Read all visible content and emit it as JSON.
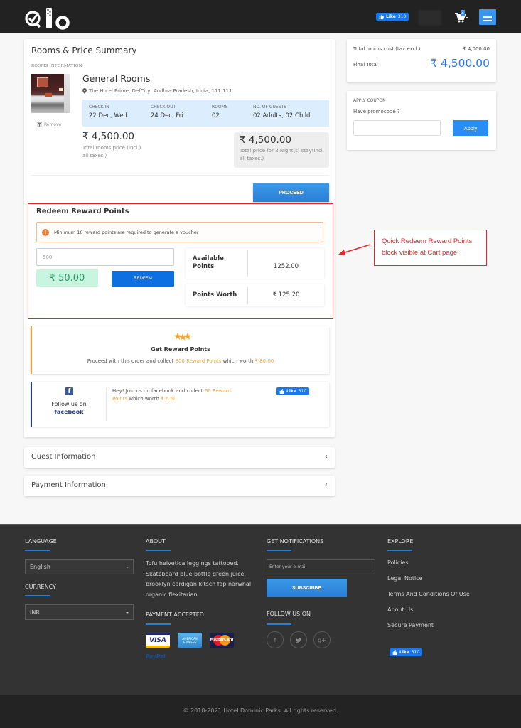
{
  "header": {
    "logo_text": "Qlo",
    "fb_like_label": "Like",
    "fb_like_count": "310",
    "cart_count": "2",
    "icons": [
      "logo",
      "facebook-like-icon",
      "cart-icon",
      "menu-icon"
    ]
  },
  "rooms_summary": {
    "title": "Rooms & Price Summary",
    "section_label": "ROOMS INFORMATION",
    "remove_label": "Remove",
    "room_name": "General Rooms",
    "address": "The Hotel Prime, DefCity, Andhra Pradesh, India, 111 111",
    "booking": {
      "check_in_label": "CHECK IN",
      "check_in": "22 Dec, Wed",
      "check_out_label": "CHECK OUT",
      "check_out": "24 Dec, Fri",
      "rooms_label": "ROOMS",
      "rooms": "02",
      "guests_label": "NO. OF GUESTS",
      "guests": "02 Adults, 02 Child"
    },
    "rooms_price": "₹ 4,500.00",
    "rooms_price_note": "Total rooms price (Incl.) all taxes.)",
    "total_price": "₹ 4,500.00",
    "total_price_note": "Total price for 2 Night(s) stay(Incl. all taxes.)",
    "proceed_label": "PROCEED"
  },
  "redeem": {
    "title": "Redeem Reward Points",
    "alert": "Minimum 10 reward points are required to generate a voucher",
    "points_input_value": "500",
    "voucher_value": "₹ 50.00",
    "redeem_label": "REDEEM",
    "available_label": "Available Points",
    "available_value": "1252.00",
    "worth_label": "Points Worth",
    "worth_value": "₹ 125.20"
  },
  "annotation": {
    "text": "Quick Redeem Reward Points block visible at Cart page.",
    "color": "#e8242b"
  },
  "reward_card": {
    "title": "Get Reward Points",
    "text_prefix": "Proceed with this order and collect ",
    "points_highlight": "800 Reward Points",
    "text_middle": " which worth ",
    "worth_highlight": "₹ 80.00"
  },
  "facebook_card": {
    "follow_text": "Follow us on",
    "follow_brand": "facebook",
    "text_prefix": "Hey! Join us on facebook and collect ",
    "points_highlight": "66 Reward Points",
    "text_middle": " which worth ",
    "worth_highlight": "₹ 6.60",
    "like_label": "Like",
    "like_count": "310"
  },
  "accordions": [
    {
      "title": "Guest Information"
    },
    {
      "title": "Payment Information"
    }
  ],
  "price_summary": {
    "rooms_cost_label": "Total rooms cost (tax excl.)",
    "rooms_cost_value": "₹ 4,000.00",
    "final_total_label": "Final Total",
    "final_total_value": "₹ 4,500.00"
  },
  "coupon": {
    "title": "APPLY COUPON",
    "question": "Have promocode ?",
    "input_value": "",
    "apply_label": "Apply"
  },
  "footer": {
    "language_heading": "LANGUAGE",
    "language_value": "English",
    "currency_heading": "CURRENCY",
    "currency_value": "INR",
    "about_heading": "ABOUT",
    "about_text": "Tofu helvetica leggings tattooed. Skateboard blue bottle green juice, brooklyn cardigan kitsch fap narwhal organic flexitarian.",
    "payment_heading": "PAYMENT ACCEPTED",
    "payment_methods": [
      "VISA",
      "AMERICAN EXPRESS",
      "MasterCard",
      "PayPal"
    ],
    "notifications_heading": "GET NOTIFICATIONS",
    "email_placeholder": "Enter your e-mail",
    "subscribe_label": "SUBSCRIBE",
    "follow_heading": "FOLLOW US ON",
    "social": [
      {
        "name": "facebook",
        "glyph": "f"
      },
      {
        "name": "twitter",
        "glyph": "🐦"
      },
      {
        "name": "google-plus",
        "glyph": "g+"
      }
    ],
    "explore_heading": "EXPLORE",
    "explore_links": [
      "Policies",
      "Legal Notice",
      "Terms And Conditions Of Use",
      "About Us",
      "Secure Payment"
    ],
    "fb_like_label": "Like",
    "fb_like_count": "310",
    "copyright": "© 2010-2021  Hotel Dominic Parks.  All rights reserved."
  }
}
